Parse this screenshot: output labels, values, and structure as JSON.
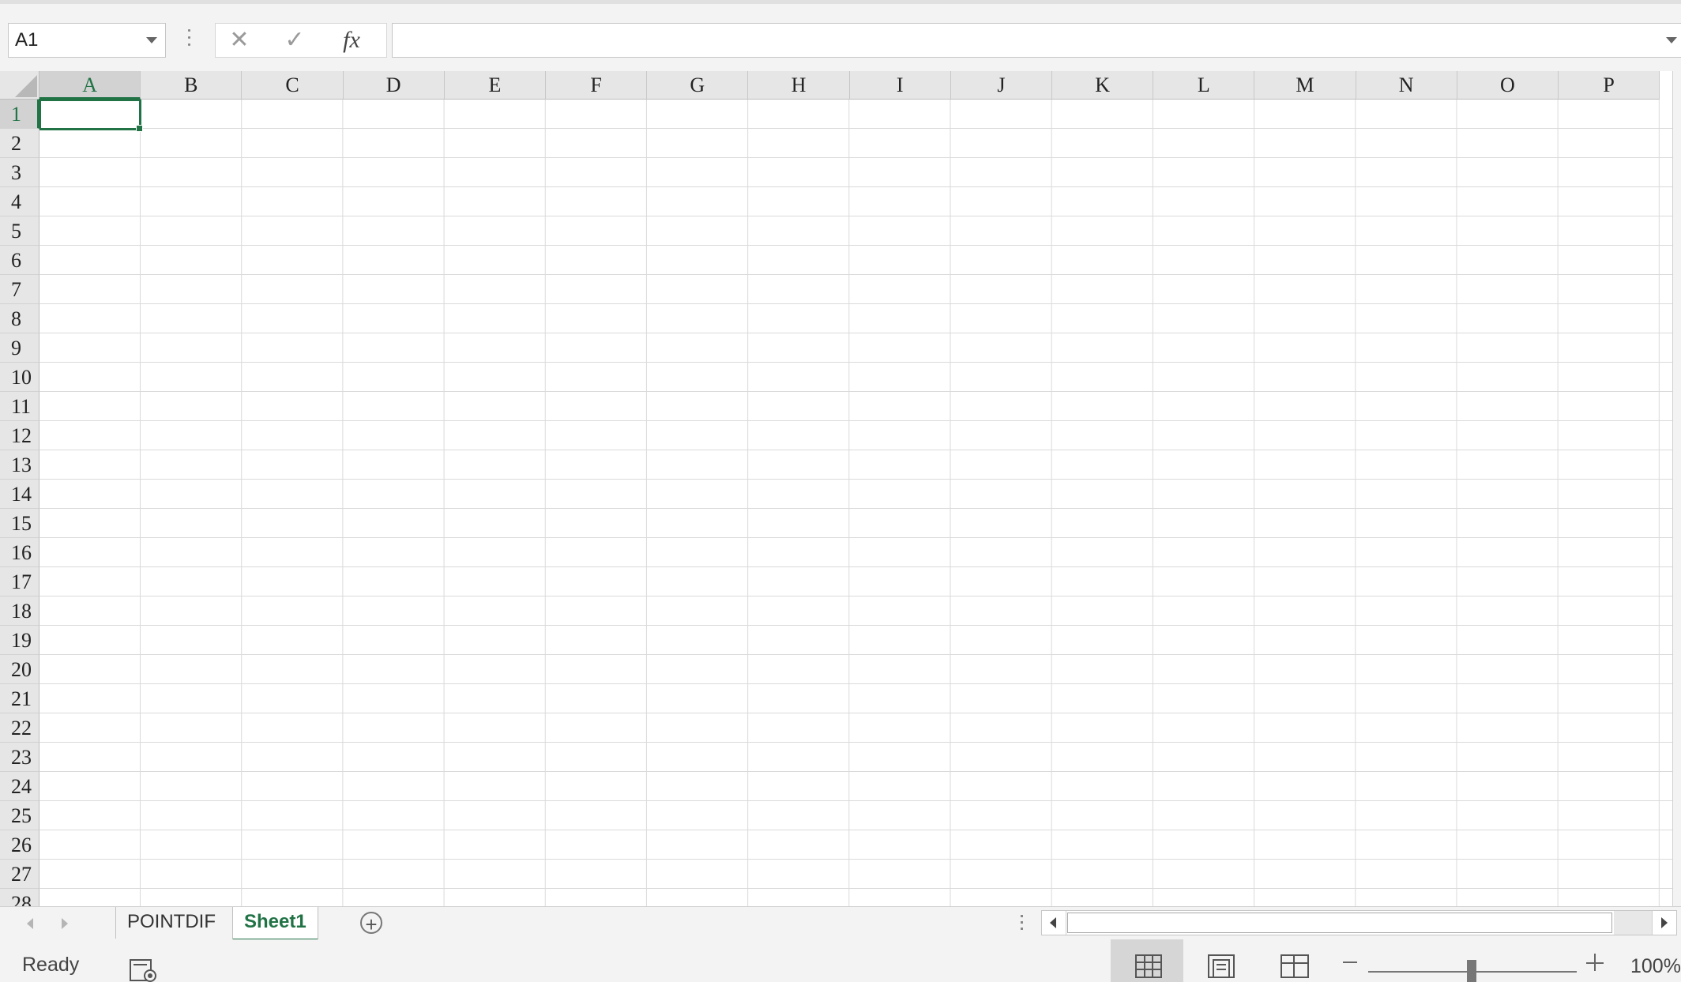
{
  "formula_bar": {
    "name_box_value": "A1",
    "formula_value": ""
  },
  "columns": [
    "A",
    "B",
    "C",
    "D",
    "E",
    "F",
    "G",
    "H",
    "I",
    "J",
    "K",
    "L",
    "M",
    "N",
    "O",
    "P"
  ],
  "rows": [
    "1",
    "2",
    "3",
    "4",
    "5",
    "6",
    "7",
    "8",
    "9",
    "10",
    "11",
    "12",
    "13",
    "14",
    "15",
    "16",
    "17",
    "18",
    "19",
    "20",
    "21",
    "22",
    "23",
    "24",
    "25",
    "26",
    "27",
    "28"
  ],
  "active_cell": "A1",
  "sheet_tabs": {
    "tabs": [
      {
        "label": "POINTDIF",
        "active": false
      },
      {
        "label": "Sheet1",
        "active": true
      }
    ]
  },
  "status_bar": {
    "status": "Ready",
    "zoom": "100%"
  },
  "colors": {
    "accent": "#217346",
    "header_bg": "#e6e6e6",
    "gridline": "#dadada"
  },
  "icons": {
    "cancel": "close-icon",
    "enter": "check-icon",
    "function": "fx-icon",
    "add_sheet": "plus-circle-icon",
    "macro": "macro-record-icon",
    "normal_view": "grid-icon",
    "page_layout": "page-layout-icon",
    "page_break": "page-break-icon"
  }
}
